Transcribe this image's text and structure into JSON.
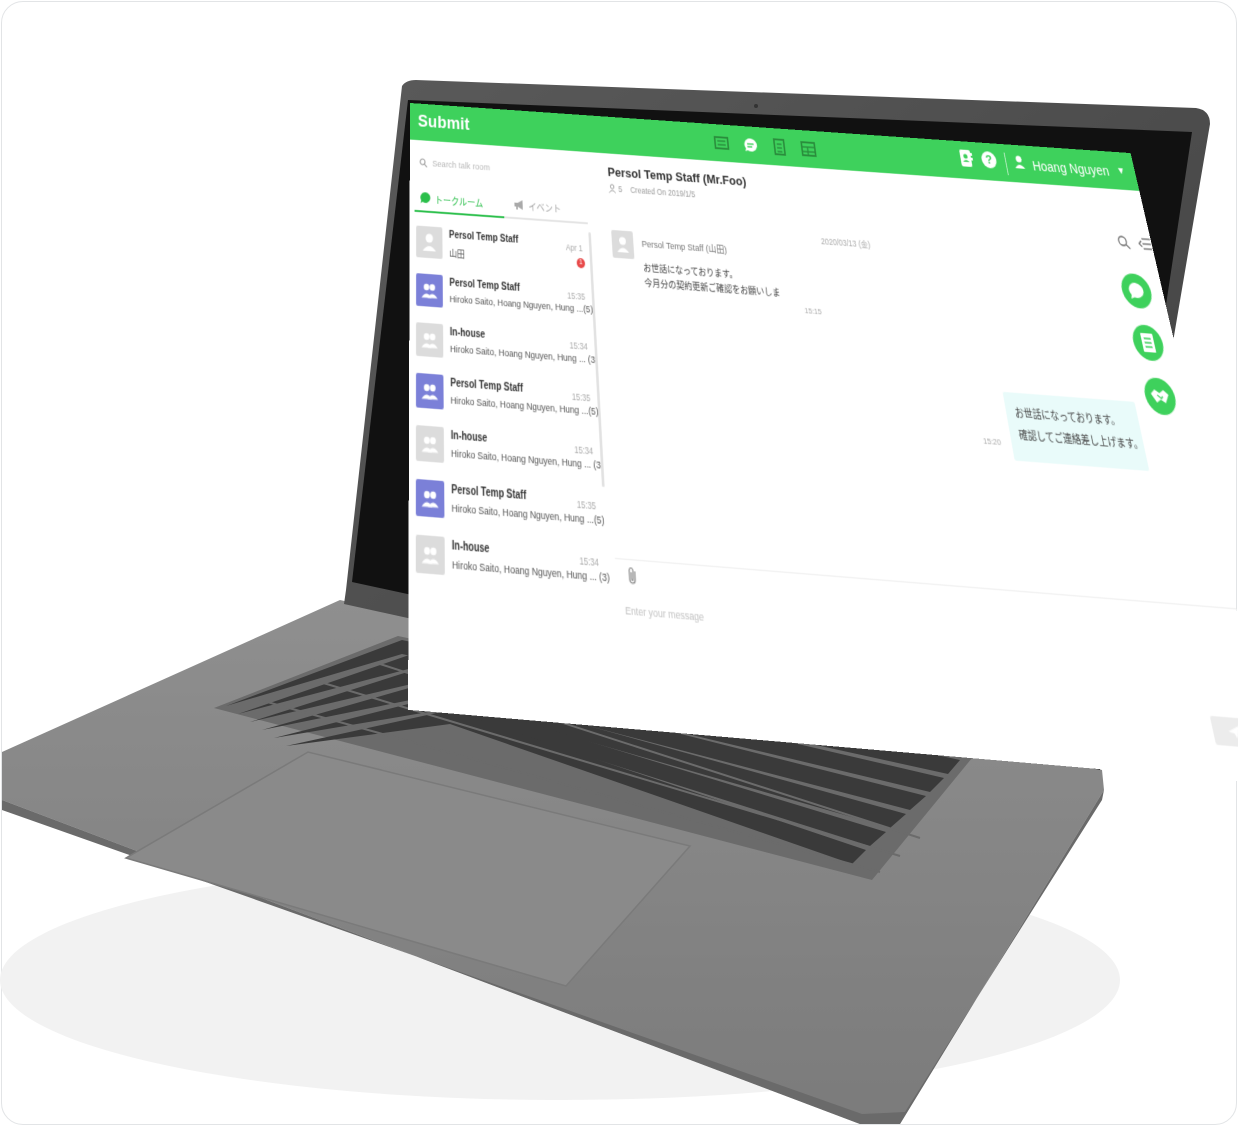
{
  "app": {
    "brand": "Submit",
    "user_name": "Hoang Nguyen",
    "colors": {
      "accent": "#3ed15c",
      "accent_text": "#2bbf4b",
      "group_avatar": "#7b80d8",
      "badge": "#e84a4a",
      "bubble_out": "#e9fbfa"
    },
    "top_icons": [
      "chat-list-icon",
      "chat-bubble-icon",
      "document-icon",
      "table-icon"
    ],
    "top_right_icons": [
      "contact-book-icon",
      "help-icon",
      "user-icon"
    ]
  },
  "sidebar": {
    "search_placeholder": "Search talk room",
    "tabs": [
      {
        "label": "トークルーム",
        "icon": "chat-icon",
        "active": true
      },
      {
        "label": "イベント",
        "icon": "megaphone-icon",
        "active": false
      }
    ],
    "rooms": [
      {
        "name": "Persol Temp Staff",
        "sub": "山田",
        "time": "Apr 1",
        "avatar": "person",
        "badge": "1"
      },
      {
        "name": "Persol Temp Staff",
        "sub": "Hiroko Saito, Hoang Nguyen, Hung ...(5)",
        "time": "15:35",
        "avatar": "group-purple"
      },
      {
        "name": "In-house",
        "sub": "Hiroko Saito, Hoang Nguyen, Hung ... (3)",
        "time": "15:34",
        "avatar": "group-gray"
      },
      {
        "name": "Persol Temp Staff",
        "sub": "Hiroko Saito, Hoang Nguyen, Hung ...(5)",
        "time": "15:35",
        "avatar": "group-purple"
      },
      {
        "name": "In-house",
        "sub": "Hiroko Saito, Hoang Nguyen, Hung ... (3)",
        "time": "15:34",
        "avatar": "group-gray"
      },
      {
        "name": "Persol Temp Staff",
        "sub": "Hiroko Saito, Hoang Nguyen, Hung ...(5)",
        "time": "15:35",
        "avatar": "group-purple"
      },
      {
        "name": "In-house",
        "sub": "Hiroko Saito, Hoang Nguyen, Hung ... (3)",
        "time": "15:34",
        "avatar": "group-gray"
      }
    ]
  },
  "conversation": {
    "title": "Persol Temp Staff (Mr.Foo)",
    "member_count": "5",
    "created": "Created On 2019/1/5",
    "date_divider": "2020/03/13 (金)",
    "incoming": {
      "sender": "Persol Temp Staff (山田)",
      "line1": "お世話になっております。",
      "line2": "今月分の契約更新ご確認をお願いしま",
      "time": "15:15"
    },
    "outgoing": {
      "line1": "お世話になっております。",
      "line2": "確認してご連絡差し上げます。",
      "time": "15:20"
    },
    "composer_placeholder": "Enter your message",
    "fab_icons": [
      "chat-fab-icon",
      "document-fab-icon",
      "handshake-fab-icon"
    ]
  }
}
